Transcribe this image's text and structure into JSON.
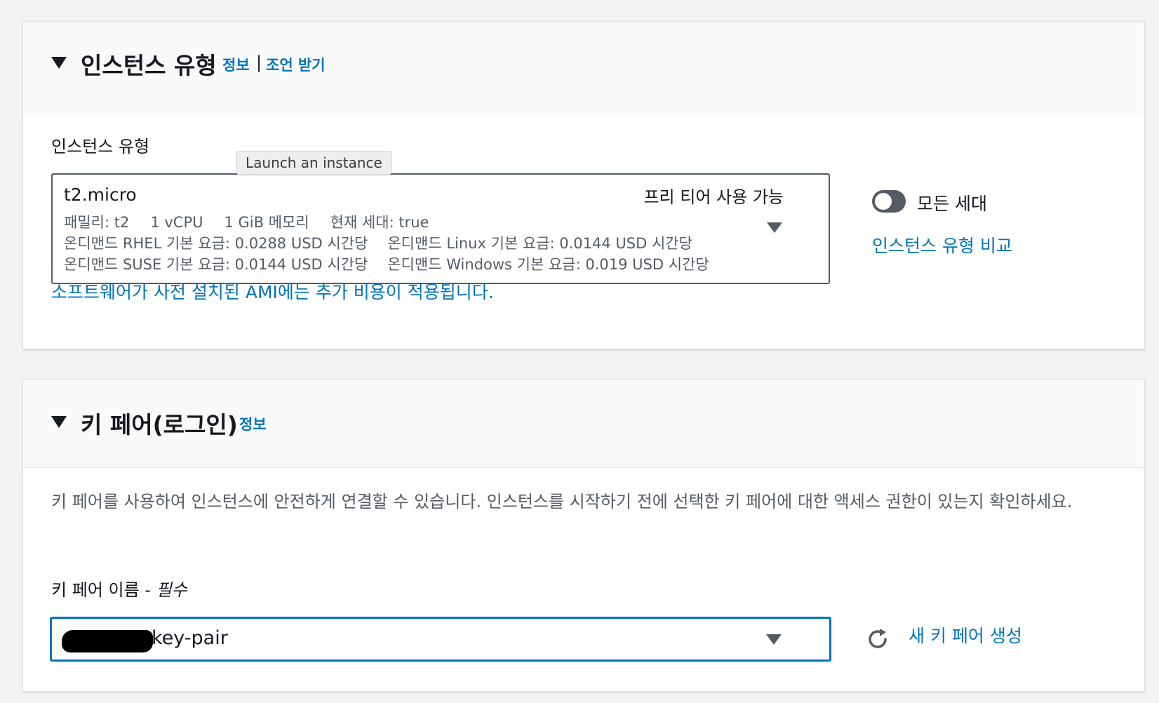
{
  "instance_panel": {
    "title": "인스턴스 유형",
    "info_link": "정보",
    "separator": "|",
    "advice_link": "조언 받기",
    "field_label": "인스턴스 유형",
    "tooltip": "Launch an instance",
    "selected": {
      "name": "t2.micro",
      "badge": "프리 티어 사용 가능",
      "family": "패밀리: t2",
      "vcpu": "1 vCPU",
      "memory": "1 GiB 메모리",
      "generation": "현재 세대: true",
      "rhel_price": "온디맨드 RHEL 기본 요금: 0.0288 USD 시간당",
      "linux_price": "온디맨드 Linux 기본 요금: 0.0144 USD 시간당",
      "suse_price": "온디맨드 SUSE 기본 요금: 0.0144 USD 시간당",
      "windows_price": "온디맨드 Windows 기본 요금: 0.019 USD 시간당"
    },
    "all_generations_label": "모든 세대",
    "all_generations_on": false,
    "compare_link": "인스턴스 유형 비교",
    "ami_notice": "소프트웨어가 사전 설치된 AMI에는 추가 비용이 적용됩니다."
  },
  "keypair_panel": {
    "title": "키 페어(로그인)",
    "info_link": "정보",
    "description": "키 페어를 사용하여 인스턴스에 안전하게 연결할 수 있습니다. 인스턴스를 시작하기 전에 선택한 키 페어에 대한 액세스 권한이 있는지 확인하세요.",
    "field_label": "키 페어 이름 - ",
    "required_label": "필수",
    "selected_value": "key-pair",
    "create_link": "새 키 페어 생성"
  },
  "colors": {
    "link": "#0073bb",
    "text": "#16191f",
    "secondary_text": "#545b64",
    "background": "#f2f3f3"
  }
}
